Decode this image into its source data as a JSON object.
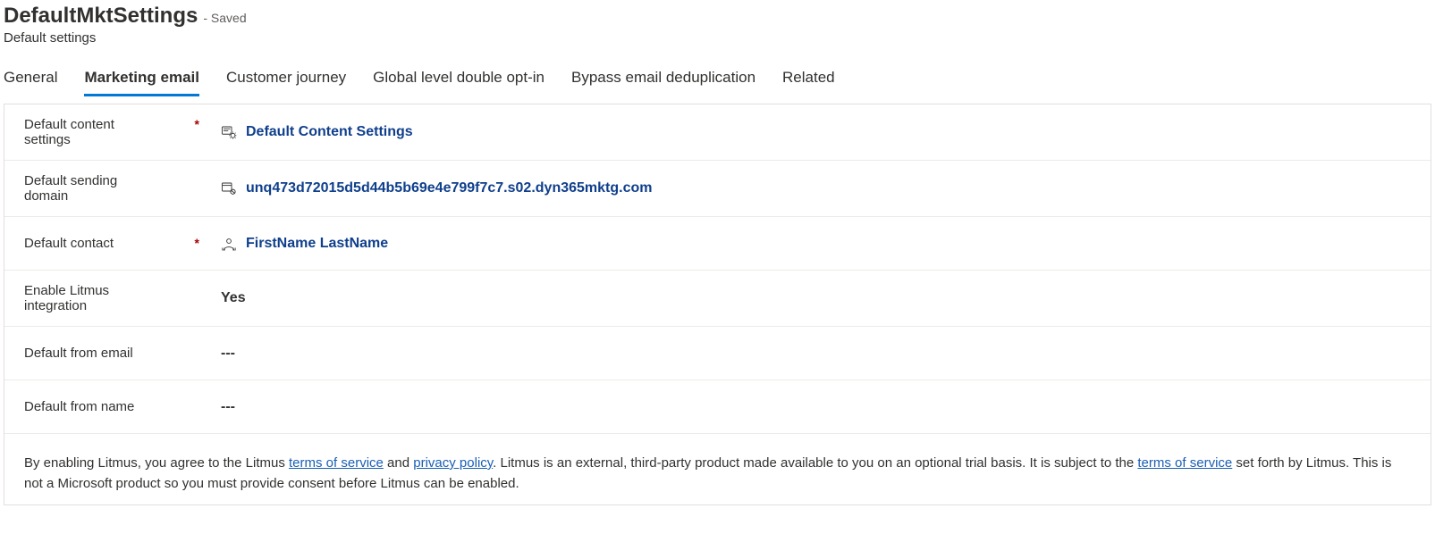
{
  "header": {
    "title": "DefaultMktSettings",
    "status": "- Saved",
    "subtitle": "Default settings"
  },
  "tabs": {
    "general": "General",
    "marketing_email": "Marketing email",
    "customer_journey": "Customer journey",
    "double_optin": "Global level double opt-in",
    "bypass_dedup": "Bypass email deduplication",
    "related": "Related"
  },
  "fields": {
    "default_content_settings": {
      "label": "Default content settings",
      "value": "Default Content Settings"
    },
    "default_sending_domain": {
      "label": "Default sending domain",
      "value": "unq473d72015d5d44b5b69e4e799f7c7.s02.dyn365mktg.com"
    },
    "default_contact": {
      "label": "Default contact",
      "value": "FirstName LastName"
    },
    "enable_litmus": {
      "label": "Enable Litmus integration",
      "value": "Yes"
    },
    "default_from_email": {
      "label": "Default from email",
      "value": "---"
    },
    "default_from_name": {
      "label": "Default from name",
      "value": "---"
    },
    "required_marker": "*"
  },
  "consent": {
    "part1": "By enabling Litmus, you agree to the Litmus ",
    "tos_link": "terms of service",
    "part2": " and ",
    "privacy_link": "privacy policy",
    "part3": ". Litmus is an external, third-party product made available to you on an optional trial basis. It is subject to the ",
    "tos_link2": "terms of service",
    "part4": " set forth by Litmus. This is not a Microsoft product so you must provide consent before Litmus can be enabled."
  }
}
